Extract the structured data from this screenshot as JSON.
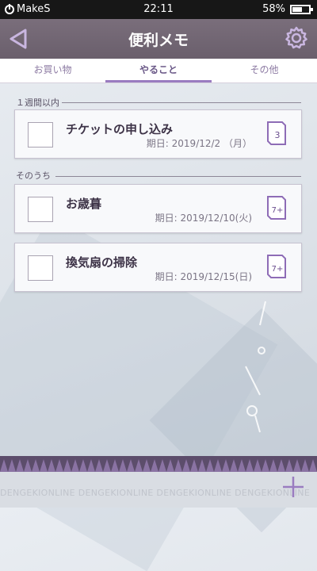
{
  "status_bar": {
    "brand": "MakeS",
    "time": "22:11",
    "battery": "58%",
    "battery_level": 0.58
  },
  "header": {
    "title": "便利メモ",
    "back_icon": "back-arrow-icon",
    "settings_icon": "gear-icon"
  },
  "tabs": [
    {
      "label": "お買い物",
      "active": false
    },
    {
      "label": "やること",
      "active": true
    },
    {
      "label": "その他",
      "active": false
    }
  ],
  "sections": [
    {
      "label": "１週間以内",
      "items": [
        {
          "title": "チケットの申し込み",
          "date": "期日: 2019/12/2 （月）",
          "badge": "3",
          "checked": false
        }
      ]
    },
    {
      "label": "そのうち",
      "items": [
        {
          "title": "お歳暮",
          "date": "期日: 2019/12/10(火)",
          "badge": "7+",
          "checked": false
        },
        {
          "title": "換気扇の掃除",
          "date": "期日: 2019/12/15(日)",
          "badge": "7+",
          "checked": false
        }
      ]
    }
  ],
  "footer": {
    "watermark": "DENGEKIONLINE DENGEKIONLINE DENGEKIONLINE DENGEKIONLINE",
    "add_icon": "plus-icon"
  },
  "colors": {
    "header": "#6a5f6c",
    "accent": "#9a7cc0",
    "statusbar": "#171717"
  }
}
